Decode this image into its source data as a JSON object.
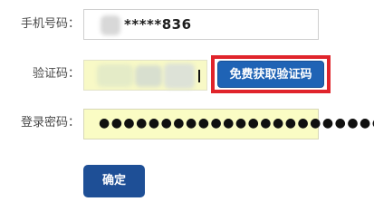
{
  "form": {
    "phone_label": "手机号码：",
    "phone_value": "*****836",
    "code_label": "验证码：",
    "code_button": "免费获取验证码",
    "password_label": "登录密码：",
    "password_value": "●●●●●●●●●●●●●●●●●●●●●●●",
    "submit_label": "确定"
  },
  "colors": {
    "primary_button": "#1f63b5",
    "submit_button": "#1e4f96",
    "highlight_border": "#e0242b",
    "autofill_background": "#fafcc4"
  }
}
